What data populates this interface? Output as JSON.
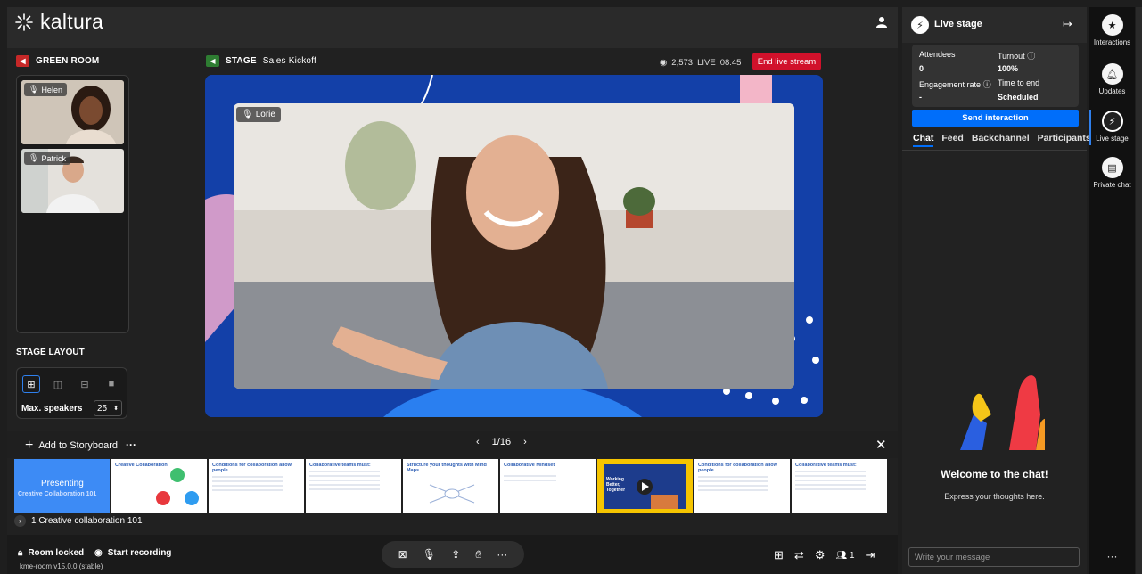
{
  "header": {
    "brand": "kaltura"
  },
  "green_room": {
    "title": "GREEN ROOM",
    "participants": [
      {
        "name": "Helen"
      },
      {
        "name": "Patrick"
      }
    ]
  },
  "stage": {
    "label": "STAGE",
    "session_name": "Sales Kickoff",
    "viewers": "2,573",
    "live_label": "LIVE",
    "live_time": "08:45",
    "end_button": "End live stream",
    "speaker_name": "Lorie"
  },
  "stage_layout": {
    "title": "STAGE LAYOUT",
    "max_speakers_label": "Max. speakers",
    "max_speakers_value": "25"
  },
  "storyboard": {
    "add_label": "Add to Storyboard",
    "more": "···",
    "page": "1/16",
    "deck_name": "1  Creative collaboration 101",
    "slides": [
      {
        "title": "Presenting",
        "subtitle": "Creative Collaboration 101"
      },
      {
        "title": "Creative Collaboration",
        "subtitle": ""
      },
      {
        "title": "Conditions for collaboration allow people",
        "subtitle": ""
      },
      {
        "title": "Collaborative teams must:",
        "subtitle": ""
      },
      {
        "title": "Structure your thoughts with Mind Maps",
        "subtitle": ""
      },
      {
        "title": "Collaborative Mindset",
        "subtitle": ""
      },
      {
        "title": "Working Better, Together",
        "subtitle": ""
      },
      {
        "title": "Conditions for collaboration allow people",
        "subtitle": ""
      },
      {
        "title": "Collaborative teams must:",
        "subtitle": ""
      }
    ]
  },
  "bottom": {
    "room_locked": "Room locked",
    "start_recording": "Start recording",
    "version": "kme-room v15.0.0 (stable)",
    "participants_count": "1"
  },
  "live_stage_panel": {
    "title": "Live stage",
    "stats": {
      "attendees_label": "Attendees",
      "attendees_value": "0",
      "turnout_label": "Turnout",
      "turnout_value": "100%",
      "engagement_label": "Engagement rate",
      "engagement_value": "-",
      "time_label": "Time to end",
      "time_value": "Scheduled"
    },
    "send_button": "Send interaction",
    "tabs": [
      "Chat",
      "Feed",
      "Backchannel",
      "Participants"
    ],
    "welcome_title": "Welcome to the chat!",
    "welcome_sub": "Express your thoughts here.",
    "input_placeholder": "Write your message"
  },
  "rail": {
    "items": [
      "Interactions",
      "Updates",
      "Live stage",
      "Private chat"
    ],
    "more": "···"
  },
  "colors": {
    "accent": "#006efa",
    "end_stream": "#d1112b",
    "stage_bg": "#1340a8"
  }
}
